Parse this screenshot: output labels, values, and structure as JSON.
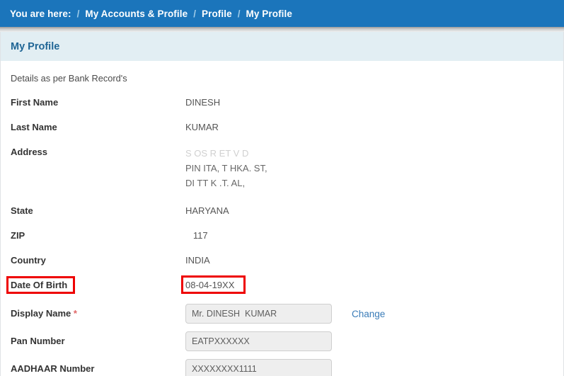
{
  "breadcrumb": {
    "prefix": "You are here:",
    "separator": "/",
    "items": [
      {
        "label": "My Accounts & Profile"
      },
      {
        "label": "Profile"
      },
      {
        "label": "My Profile"
      }
    ]
  },
  "panel": {
    "title": "My Profile",
    "intro": "Details as per Bank Record's"
  },
  "fields": {
    "first_name": {
      "label": "First Name",
      "value": "DINESH"
    },
    "last_name": {
      "label": "Last Name",
      "value": "KUMAR"
    },
    "address": {
      "label": "Address",
      "line1": "S  OS   R  ET V  D",
      "line2": "PIN     ITA, T   HKA.  ST,",
      "line3": "DI  TT K  .T. AL,"
    },
    "state": {
      "label": "State",
      "value": "HARYANA"
    },
    "zip": {
      "label": "ZIP",
      "value_masked": "117"
    },
    "country": {
      "label": "Country",
      "value": "INDIA"
    },
    "dob": {
      "label": "Date Of Birth",
      "value": "08-04-19XX"
    },
    "display_name": {
      "label": "Display Name",
      "required_mark": "*",
      "value": "Mr. DINESH  KUMAR",
      "action": "Change"
    },
    "pan_number": {
      "label": "Pan Number",
      "value": "EATPXXXXXX"
    },
    "aadhaar_number": {
      "label": "AADHAAR Number",
      "value": "XXXXXXXX1111"
    }
  },
  "colors": {
    "breadcrumb_bg": "#1b75bb",
    "panel_head_bg": "#e2eef3",
    "panel_title": "#1f6595",
    "link": "#3a7cb8",
    "highlight": "#ee0000",
    "required": "#e06666"
  }
}
